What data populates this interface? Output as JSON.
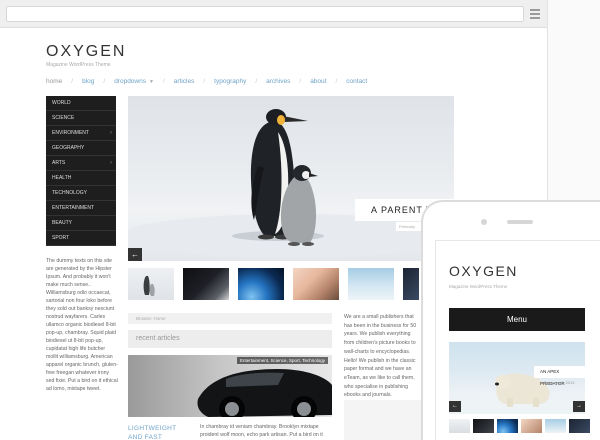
{
  "desktop": {
    "site": {
      "title": "OXYGEN",
      "tagline": "Magazine WordPress Theme"
    },
    "nav": [
      {
        "label": "home",
        "active": true
      },
      {
        "label": "blog"
      },
      {
        "label": "dropdowns",
        "has_caret": true
      },
      {
        "label": "articles"
      },
      {
        "label": "typography"
      },
      {
        "label": "archives"
      },
      {
        "label": "about"
      },
      {
        "label": "contact"
      }
    ],
    "categories": [
      {
        "label": "WORLD"
      },
      {
        "label": "SCIENCE"
      },
      {
        "label": "ENVIRONMENT",
        "has_children": true
      },
      {
        "label": "GEOGRAPHY"
      },
      {
        "label": "ARTS",
        "has_children": true
      },
      {
        "label": "HEALTH"
      },
      {
        "label": "TECHNOLOGY"
      },
      {
        "label": "ENTERTAINMENT"
      },
      {
        "label": "BEAUTY"
      },
      {
        "label": "SPORT"
      }
    ],
    "sidebar_text": "The dummy texts on this site are generated by the Hipster Ipsum. And probably it won't make much sense.. Williamsburg odio occaecat, sartorial non four loko before they sold out banksy nesciunt nostrud wayfarers. Carles ullamco organic biodiesel 8-bit pop-up, chambray. Squid plaid biodiesel ut 8-bit pop-up, cupidatat high life butcher mollit williamsburg. American apparel organic brunch, gluten-free freegan whatever irony sed fixie. Put a bird on it ethical ad lomo, mixtape tweet.",
    "hero": {
      "caption": "A PARENT THE",
      "date": "February",
      "prev_icon": "←"
    },
    "breadcrumb": "Browse: Home",
    "recent_title": "recent articles",
    "post": {
      "tags": "Entertainment, Science, Sport, Technology",
      "title": "LIGHTWEIGHT AND FAST",
      "excerpt": "In chambray id veniam chambray. Brooklyn mixtape proident wolf moon, echo park artisan. Put a bird on it"
    },
    "right_text": "We are a small publishers that has been in the business for 50 years. We publish everything from children's picture books to wall-charts to encyclopedias. Hello! We publish in the classic paper format and we have an eTeam, as we like to call them, who specialise in publishing ebooks and journals."
  },
  "mobile": {
    "site": {
      "title": "OXYGEN",
      "tagline": "Magazine WordPress Theme"
    },
    "menu_label": "Menu",
    "slide": {
      "caption": "AN APEX PREDATOR",
      "date": "February 5, 2013",
      "prev_icon": "←",
      "next_icon": "→"
    }
  }
}
